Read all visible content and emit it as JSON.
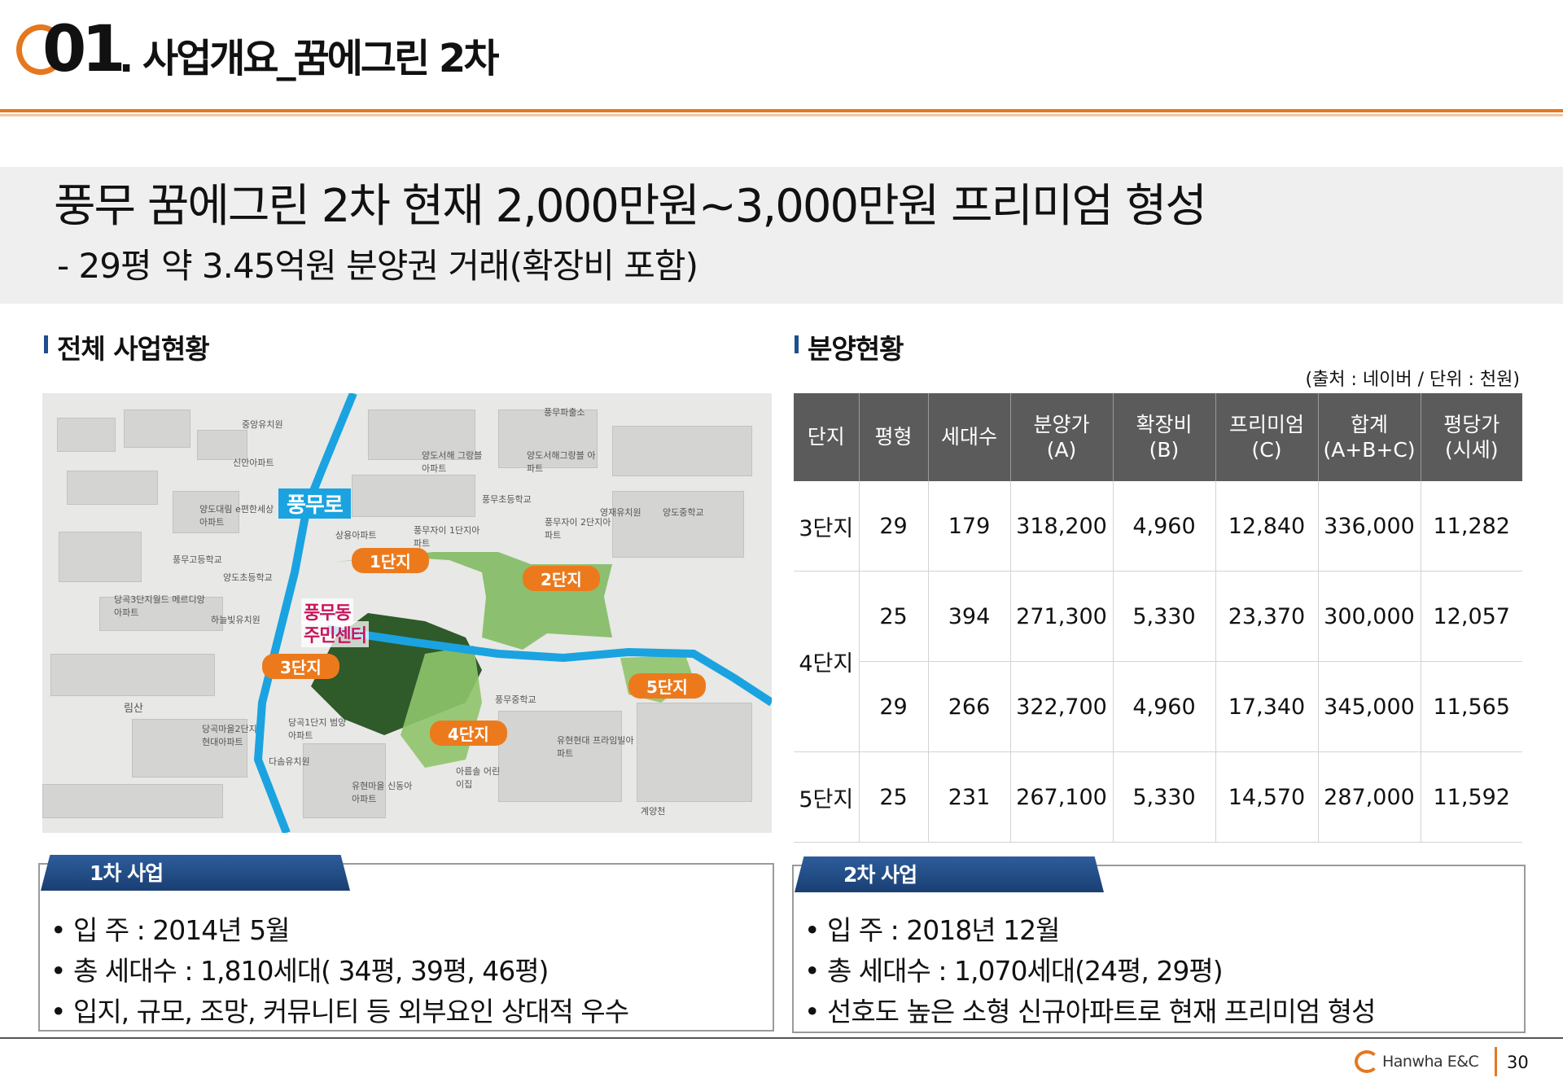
{
  "header": {
    "number": "01",
    "title": ". 사업개요_꿈에그린 2차"
  },
  "headline": {
    "title": "풍무 꿈에그린 2차 현재 2,000만원~3,000만원 프리미엄 형성",
    "subtitle": "- 29평 약 3.45억원 분양권 거래(확장비 포함)"
  },
  "left_section": {
    "title": "전체 사업현황",
    "map": {
      "road_label": "풍무로",
      "center_label_1": "풍무동",
      "center_label_2": "주민센터",
      "tags": [
        "1단지",
        "2단지",
        "3단지",
        "4단지",
        "5단지"
      ],
      "place_labels": [
        "중앙유치원",
        "신안아파트",
        "양도대림 e편한세상아파트",
        "풍무고등학교",
        "양도초등학교",
        "당곡3단지월드 메르디앙아파트",
        "하늘빛유치원",
        "양도서해 그랑블아파트",
        "양도서해그랑블 아파트",
        "풍무초등학교",
        "풍무파출소",
        "영재유치원",
        "양도중학교",
        "상용아파트",
        "풍무자이 1단지아파트",
        "풍무자이 2단지아파트",
        "풍무중학교",
        "유현현대 프라임빌아파트",
        "당곡1단지 범양아파트",
        "당곡마을2단지 현대아파트",
        "다솜유치원",
        "유현마을 신동아아파트",
        "아름솔 어린이집",
        "림산",
        "계양천"
      ]
    }
  },
  "right_section": {
    "title": "분양현황",
    "source_note": "(출처 : 네이버 / 단위 : 천원)",
    "table": {
      "headers": [
        [
          "단지"
        ],
        [
          "평형"
        ],
        [
          "세대수"
        ],
        [
          "분양가",
          "(A)"
        ],
        [
          "확장비",
          "(B)"
        ],
        [
          "프리미엄",
          "(C)"
        ],
        [
          "합계",
          "(A+B+C)"
        ],
        [
          "평당가",
          "(시세)"
        ]
      ],
      "rows": [
        {
          "complex": "3단지",
          "cells": [
            "29",
            "179",
            "318,200",
            "4,960",
            "12,840",
            "336,000",
            "11,282"
          ]
        },
        {
          "complex": "4단지",
          "cells": [
            "25",
            "394",
            "271,300",
            "5,330",
            "23,370",
            "300,000",
            "12,057"
          ]
        },
        {
          "complex": "",
          "cells": [
            "29",
            "266",
            "322,700",
            "4,960",
            "17,340",
            "345,000",
            "11,565"
          ]
        },
        {
          "complex": "5단지",
          "cells": [
            "25",
            "231",
            "267,100",
            "5,330",
            "14,570",
            "287,000",
            "11,592"
          ]
        }
      ]
    }
  },
  "project1": {
    "tab": "1차 사업",
    "lines": [
      "• 입        주 : 2014년 5월",
      "• 총 세대수 : 1,810세대( 34평, 39평, 46평)",
      "• 입지, 규모, 조망, 커뮤니티 등 외부요인 상대적 우수"
    ]
  },
  "project2": {
    "tab": "2차 사업",
    "lines": [
      "• 입        주 : 2018년 12월",
      "• 총 세대수 : 1,070세대(24평, 29평)",
      "• 선호도 높은 소형 신규아파트로 현재 프리미엄 형성"
    ]
  },
  "footer": {
    "brand": "Hanwha E&C",
    "page": "30"
  },
  "colors": {
    "accent_orange": "#e5781e",
    "tab_blue": "#1f4e8c",
    "table_header": "#5b5b5b",
    "road_blue": "#1aa3e0"
  }
}
